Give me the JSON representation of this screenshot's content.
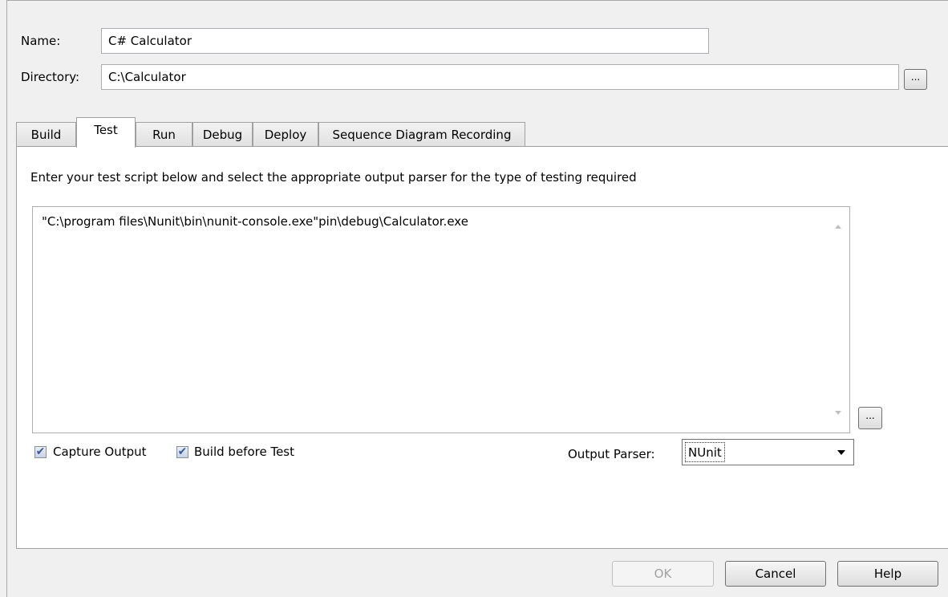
{
  "form": {
    "name_label": "Name:",
    "name_value": "C# Calculator",
    "directory_label": "Directory:",
    "directory_value": "C:\\Calculator",
    "browse_button_label": "..."
  },
  "tabs": [
    {
      "label": "Build",
      "active": false
    },
    {
      "label": "Test",
      "active": true
    },
    {
      "label": "Run",
      "active": false
    },
    {
      "label": "Debug",
      "active": false
    },
    {
      "label": "Deploy",
      "active": false
    },
    {
      "label": "Sequence Diagram Recording",
      "active": false
    }
  ],
  "test_tab": {
    "instructions": "Enter your test script below and select the appropriate output parser for the type of testing required",
    "script": "\"C:\\program files\\Nunit\\bin\\nunit-console.exe\"pin\\debug\\Calculator.exe",
    "script_browse_label": "...",
    "capture_output_label": "Capture Output",
    "capture_output_checked": true,
    "build_before_test_label": "Build before Test",
    "build_before_test_checked": true,
    "output_parser_label": "Output Parser:",
    "output_parser_value": "NUnit"
  },
  "footer": {
    "ok_label": "OK",
    "ok_enabled": false,
    "cancel_label": "Cancel",
    "help_label": "Help"
  }
}
